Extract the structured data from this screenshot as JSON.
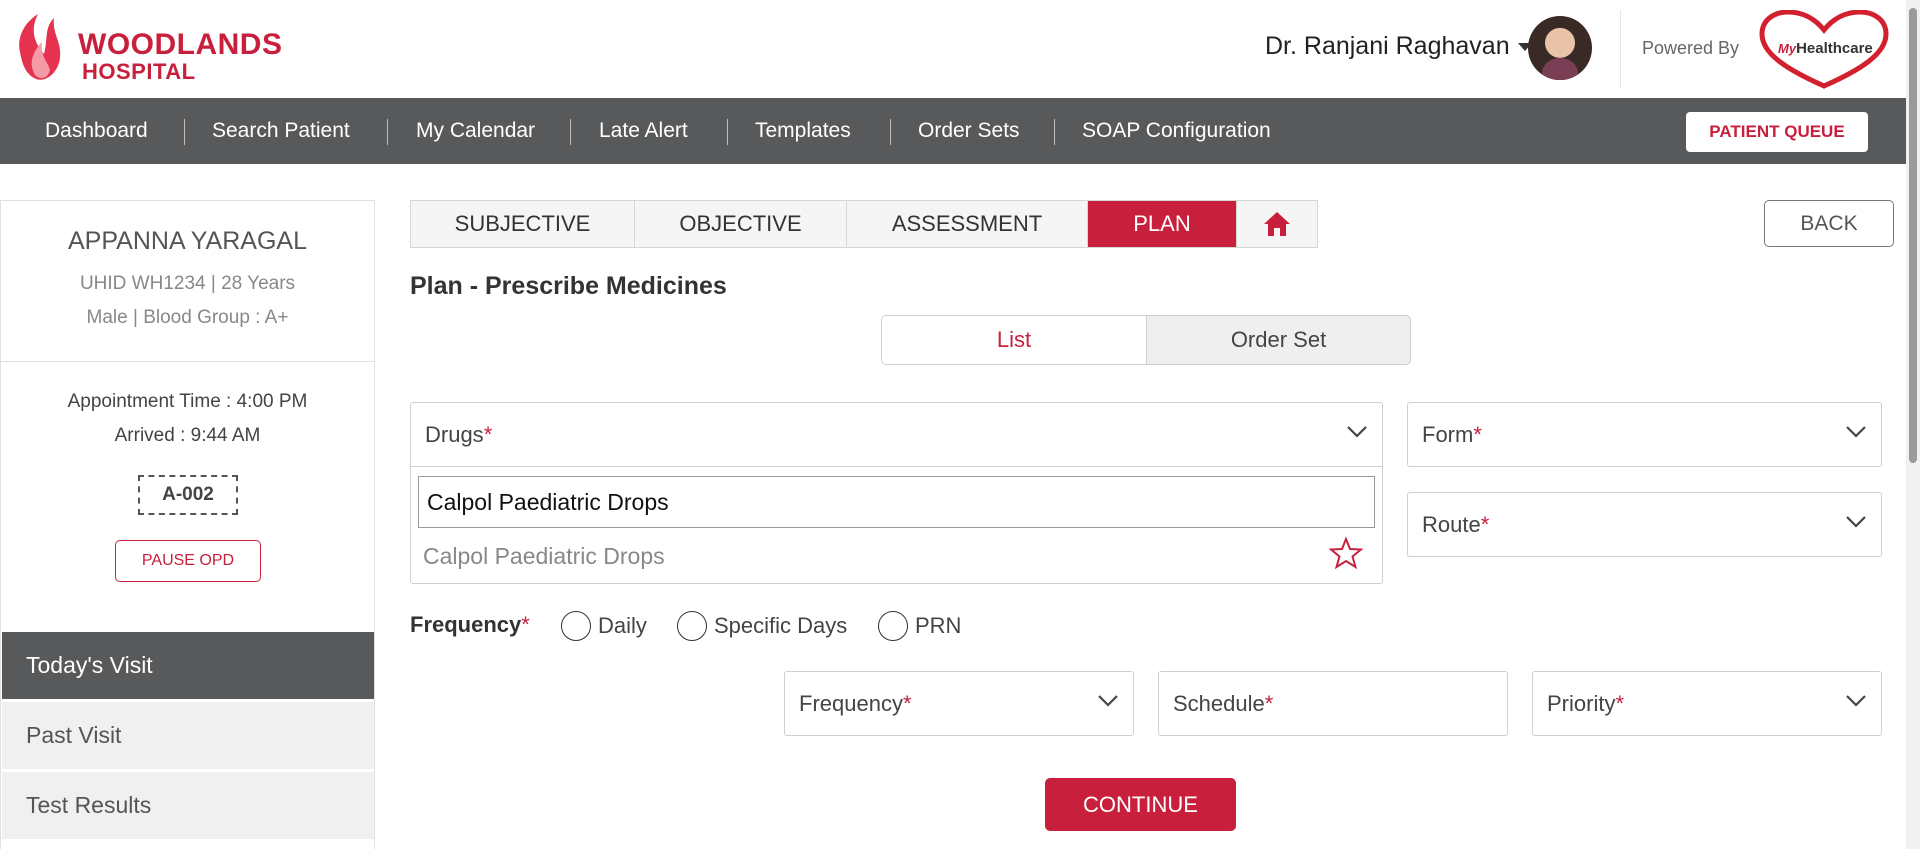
{
  "header": {
    "logo_line1": "WOODLANDS",
    "logo_line2": "HOSPITAL",
    "user_name": "Dr. Ranjani Raghavan",
    "powered_by": "Powered By",
    "brand_prefix": "My",
    "brand_name": "Healthcare"
  },
  "nav": {
    "items": [
      "Dashboard",
      "Search Patient",
      "My Calendar",
      "Late Alert",
      "Templates",
      "Order Sets",
      "SOAP Configuration"
    ],
    "queue_button": "PATIENT QUEUE"
  },
  "patient": {
    "name": "APPANNA YARAGAL",
    "uhid_age": "UHID WH1234 | 28 Years",
    "gender_blood": "Male | Blood Group : A+",
    "appointment_time": "Appointment Time : 4:00 PM",
    "arrived": "Arrived : 9:44 AM",
    "token": "A-002",
    "pause_button": "PAUSE OPD"
  },
  "sidebar_tabs": [
    "Today's Visit",
    "Past Visit",
    "Test Results"
  ],
  "soap_tabs": [
    "SUBJECTIVE",
    "OBJECTIVE",
    "ASSESSMENT",
    "PLAN"
  ],
  "back_button": "BACK",
  "section_title": "Plan - Prescribe Medicines",
  "toggle": {
    "list": "List",
    "order_set": "Order Set"
  },
  "form": {
    "drugs_label": "Drugs",
    "drug_search_value": "Calpol Paediatric Drops",
    "drug_option": "Calpol Paediatric Drops",
    "form_label": "Form",
    "route_label": "Route",
    "frequency_label": "Frequency",
    "frequency_options": [
      "Daily",
      "Specific Days",
      "PRN"
    ],
    "frequency_select_label": "Frequency",
    "schedule_label": "Schedule",
    "priority_label": "Priority",
    "required_mark": "*",
    "continue_button": "CONTINUE"
  },
  "colors": {
    "brand_red": "#c8203c",
    "nav_gray": "#58595b"
  }
}
